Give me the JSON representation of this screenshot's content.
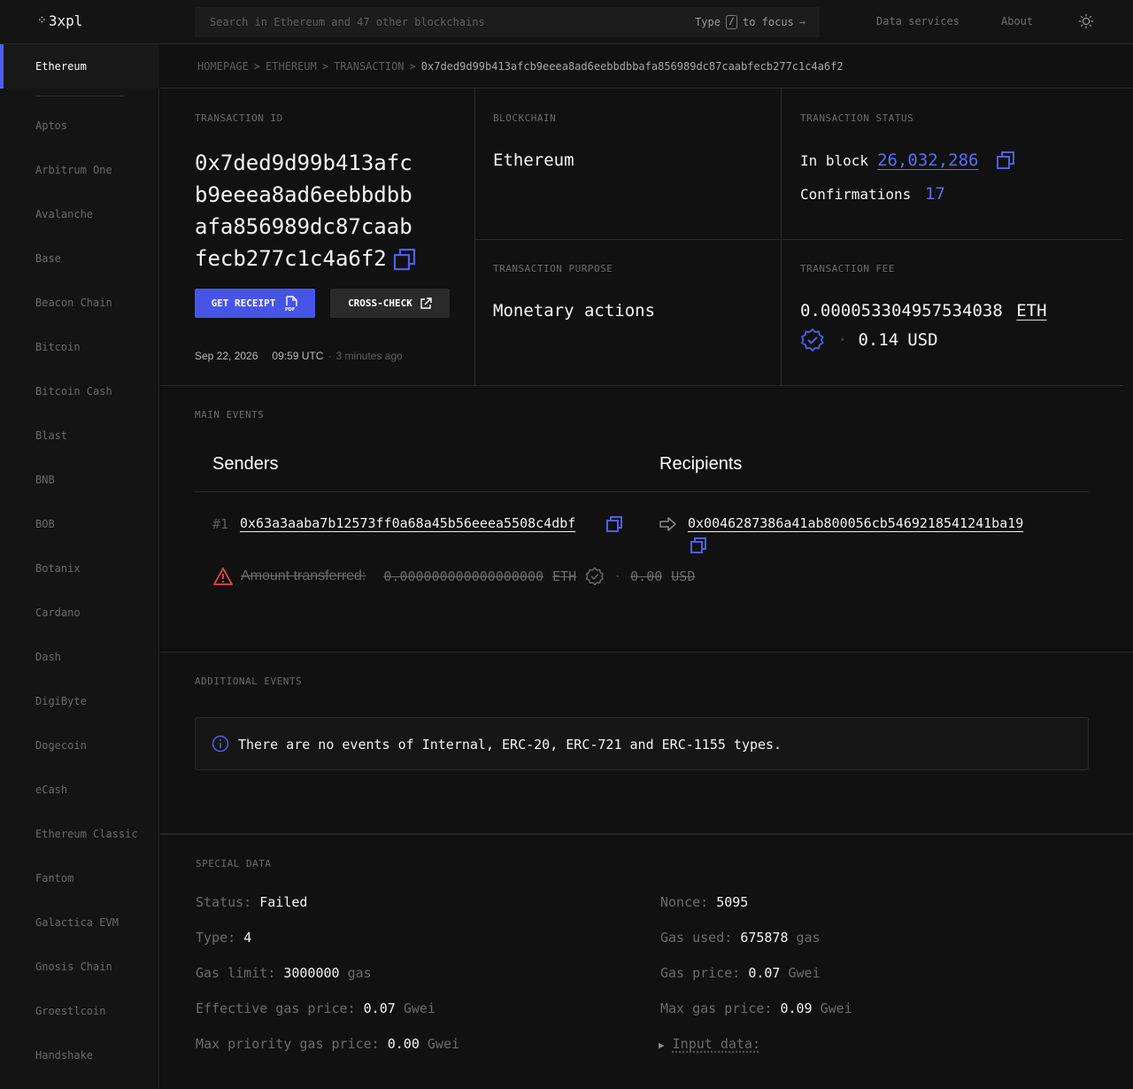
{
  "header": {
    "logo": "3xpl",
    "search_placeholder": "Search in Ethereum and 47 other blockchains",
    "hint_type": "Type",
    "hint_key": "/",
    "hint_focus": "to focus",
    "nav": [
      "Data services",
      "About"
    ]
  },
  "sidebar": {
    "active": "Ethereum",
    "items": [
      "Aptos",
      "Arbitrum One",
      "Avalanche",
      "Base",
      "Beacon Chain",
      "Bitcoin",
      "Bitcoin Cash",
      "Blast",
      "BNB",
      "BOB",
      "Botanix",
      "Cardano",
      "Dash",
      "DigiByte",
      "Dogecoin",
      "eCash",
      "Ethereum Classic",
      "Fantom",
      "Galactica EVM",
      "Gnosis Chain",
      "Groestlcoin",
      "Handshake"
    ]
  },
  "breadcrumb": {
    "items": [
      "HOMEPAGE",
      "ETHEREUM",
      "TRANSACTION"
    ],
    "separator": ">",
    "current": "0x7ded9d99b413afcb9eeea8ad6eebbdbbafa856989dc87caabfecb277c1c4a6f2"
  },
  "tx": {
    "id_label": "TRANSACTION ID",
    "id": "0x7ded9d99b413afcb9eeea8ad6eebbdbbafa856989dc87caabfecb277c1c4a6f2",
    "receipt_btn": "GET RECEIPT",
    "crosscheck_btn": "CROSS-CHECK",
    "date": "Sep 22, 2026",
    "time": "09:59 UTC",
    "ago": "3 minutes ago",
    "blockchain_label": "BLOCKCHAIN",
    "blockchain": "Ethereum",
    "status_label": "TRANSACTION STATUS",
    "in_block_label": "In block",
    "block": "26,032,286",
    "confirmations_label": "Confirmations",
    "confirmations": "17",
    "purpose_label": "TRANSACTION PURPOSE",
    "purpose": "Monetary actions",
    "fee_label": "TRANSACTION FEE",
    "fee": "0.000053304957534038",
    "fee_unit": "ETH",
    "fee_usd": "0.14",
    "fee_usd_unit": "USD"
  },
  "main_events": {
    "label": "MAIN EVENTS",
    "senders_title": "Senders",
    "recipients_title": "Recipients",
    "index": "#1",
    "sender": "0x63a3aaba7b12573ff0a68a45b56eeea5508c4dbf",
    "recipient": "0x0046287386a41ab800056cb5469218541241ba19",
    "amount_label": "Amount transferred:",
    "amount": "0.000000000000000000",
    "amount_unit": "ETH",
    "amount_usd": "0.00",
    "amount_usd_unit": "USD"
  },
  "additional_events": {
    "label": "ADDITIONAL EVENTS",
    "message": "There are no events of Internal, ERC-20, ERC-721 and ERC-1155 types."
  },
  "special_data": {
    "label": "SPECIAL DATA",
    "left": [
      {
        "key": "Status:",
        "value": "Failed",
        "unit": ""
      },
      {
        "key": "Type:",
        "value": "4",
        "unit": ""
      },
      {
        "key": "Gas limit:",
        "value": "3000000",
        "unit": "gas"
      },
      {
        "key": "Effective gas price:",
        "value": "0.07",
        "unit": "Gwei"
      },
      {
        "key": "Max priority gas price:",
        "value": "0.00",
        "unit": "Gwei"
      }
    ],
    "right": [
      {
        "key": "Nonce:",
        "value": "5095",
        "unit": ""
      },
      {
        "key": "Gas used:",
        "value": "675878",
        "unit": "gas"
      },
      {
        "key": "Gas price:",
        "value": "0.07",
        "unit": "Gwei"
      },
      {
        "key": "Max gas price:",
        "value": "0.09",
        "unit": "Gwei"
      }
    ],
    "input_data": "Input data:"
  },
  "colors": {
    "accent": "#4655e8",
    "link": "#5b6cf0",
    "warning": "#e04848",
    "bg": "#111111"
  }
}
